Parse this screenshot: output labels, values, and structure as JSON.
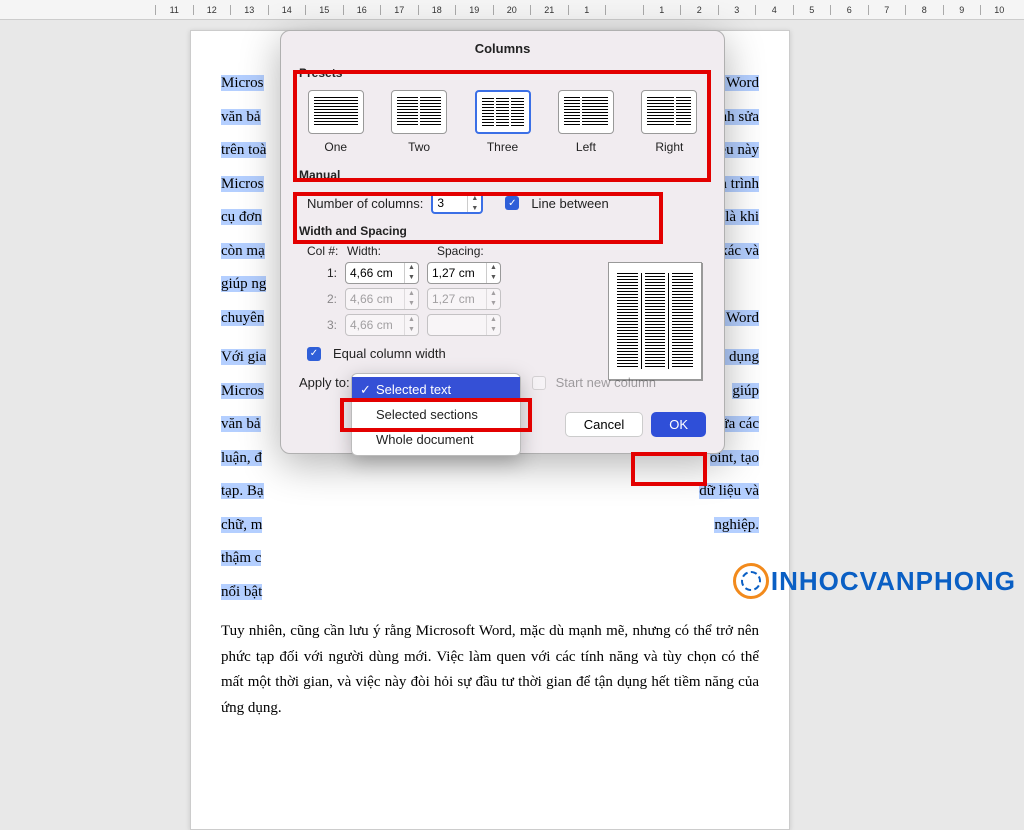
{
  "ruler": [
    "11",
    "12",
    "13",
    "14",
    "15",
    "16",
    "17",
    "18",
    "19",
    "20",
    "21",
    "1",
    "",
    "1",
    "2",
    "3",
    "4",
    "5",
    "6",
    "7",
    "8",
    "9",
    "10"
  ],
  "doc": {
    "p1_left": "Micros",
    "p1_right": "của Word",
    "p2_left": "văn bả",
    "p2_right": "hỉnh sửa",
    "p3_left": "trên toà",
    "p3_right": "Điều này",
    "p4_left": "Micros",
    "p4_right": "à trình",
    "p5_left": "cụ đơn",
    "p5_right": "là khi",
    "p6_left": "còn mạ",
    "p6_right": "xác và",
    "p7_left": "giúp ng",
    "p8_left": "chuyên",
    "p8_right": "soft Word",
    "p9_left": "Với gia",
    "p9_right": "g dụng",
    "p10_left": "Micros",
    "p10_right": "giúp",
    "p11_left": "văn bả",
    "p11_right": "giữa các",
    "p12_left": "luận, đ",
    "p12_right": "oint, tạo",
    "p13_left": "tạp. Bạ",
    "p13_right": "dữ liệu và",
    "p14_left": "chữ, m",
    "p14_right": "nghiệp.",
    "p15_left": "thậm c",
    "p16_left": "nổi bật",
    "p_unsel": "Tuy nhiên, cũng cần lưu ý rằng Microsoft Word, mặc dù mạnh mẽ, nhưng có thể trở nên phức tạp đối với người dùng mới. Việc làm quen với các tính năng và tùy chọn có thể mất một thời gian, và việc này đòi hỏi sự đầu tư thời gian để tận dụng hết tiềm năng của ứng dụng."
  },
  "dialog": {
    "title": "Columns",
    "presets_label": "Presets",
    "presets": [
      "One",
      "Two",
      "Three",
      "Left",
      "Right"
    ],
    "manual_label": "Manual",
    "num_cols_label": "Number of columns:",
    "num_cols_value": "3",
    "line_between": "Line between",
    "ws_label": "Width and Spacing",
    "col_header": "Col #:",
    "width_header": "Width:",
    "spacing_header": "Spacing:",
    "rows": [
      {
        "idx": "1:",
        "w": "4,66 cm",
        "s": "1,27 cm",
        "enabled": true
      },
      {
        "idx": "2:",
        "w": "4,66 cm",
        "s": "1,27 cm",
        "enabled": false
      },
      {
        "idx": "3:",
        "w": "4,66 cm",
        "s": "",
        "enabled": false
      }
    ],
    "equal_width": "Equal column width",
    "apply_to_label": "Apply to:",
    "apply_options": [
      "Selected text",
      "Selected sections",
      "Whole document"
    ],
    "start_new": "Start new column",
    "cancel": "Cancel",
    "ok": "OK"
  },
  "logo": "INHOCVANPHONG"
}
